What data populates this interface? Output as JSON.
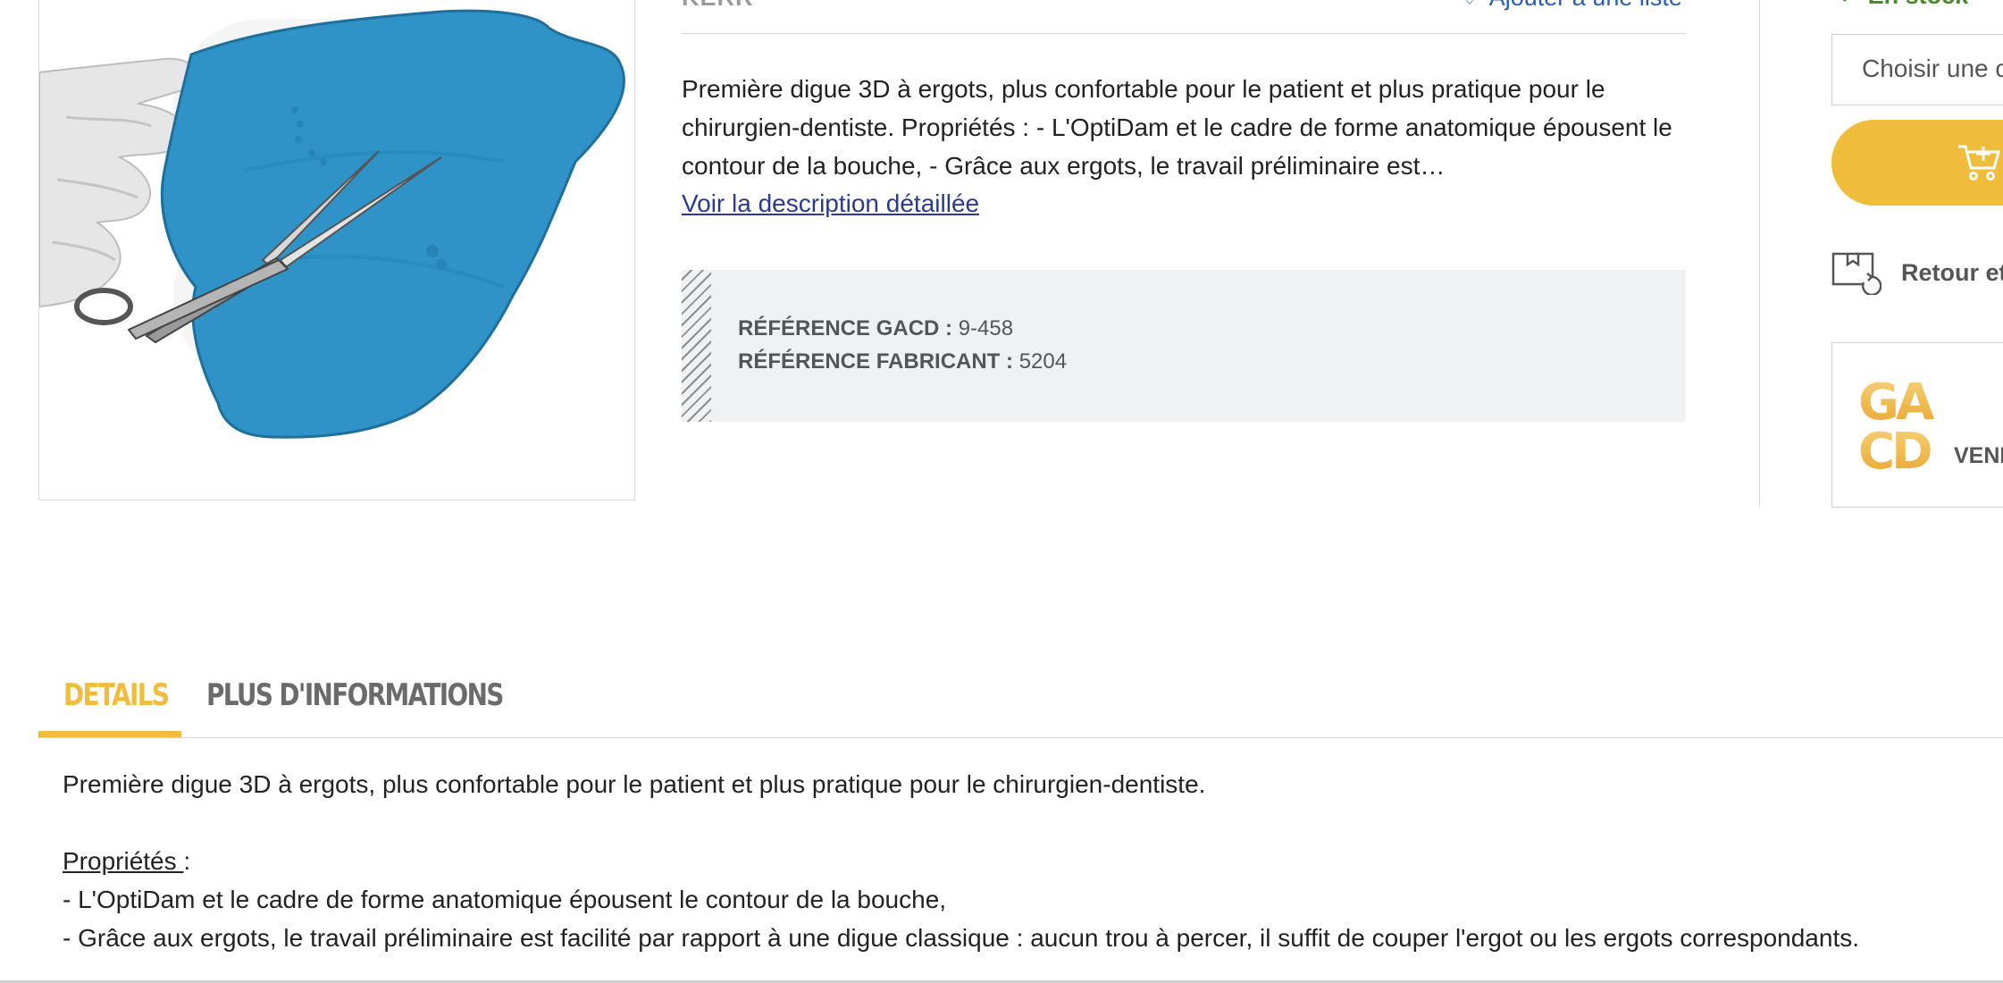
{
  "product": {
    "brand": "KERR",
    "wishlist_label": "Ajouter à une liste",
    "short_description": "Première digue 3D à ergots, plus confortable pour le patient et plus pratique pour le chirurgien-dentiste. Propriétés : - L'OptiDam et le cadre de forme anatomique épousent le contour de la bouche, - Grâce aux ergots, le travail préliminaire est…",
    "more_link": "Voir la description détaillée",
    "references": {
      "gacd_label": "RÉFÉRENCE GACD :",
      "gacd_value": "9-458",
      "maker_label": "RÉFÉRENCE FABRICANT :",
      "maker_value": "5204"
    }
  },
  "buy_box": {
    "stock_label": "En stock",
    "select_placeholder": "Choisir une c",
    "return_label": "Retour et",
    "seller_logo_lines": [
      "GA",
      "CD"
    ],
    "seller_label": "VEND"
  },
  "tabs": {
    "details": "DETAILS",
    "more_info": "PLUS D'INFORMATIONS"
  },
  "details": {
    "intro": "Première digue 3D à ergots, plus confortable pour le patient et plus pratique pour le chirurgien-dentiste.",
    "properties_title": "Propriétés ",
    "properties_colon": ":",
    "items": [
      "- L'OptiDam et le cadre de forme anatomique épousent le contour de la bouche,",
      "- Grâce aux ergots, le travail préliminaire est facilité par rapport à une digue classique : aucun trou à percer, il suffit de couper l'ergot ou les ergots correspondants."
    ]
  },
  "colors": {
    "accent": "#f0bc3c",
    "link": "#2b3a8f",
    "stock": "#4b8a2a",
    "dam_blue": "#2f93c8"
  }
}
